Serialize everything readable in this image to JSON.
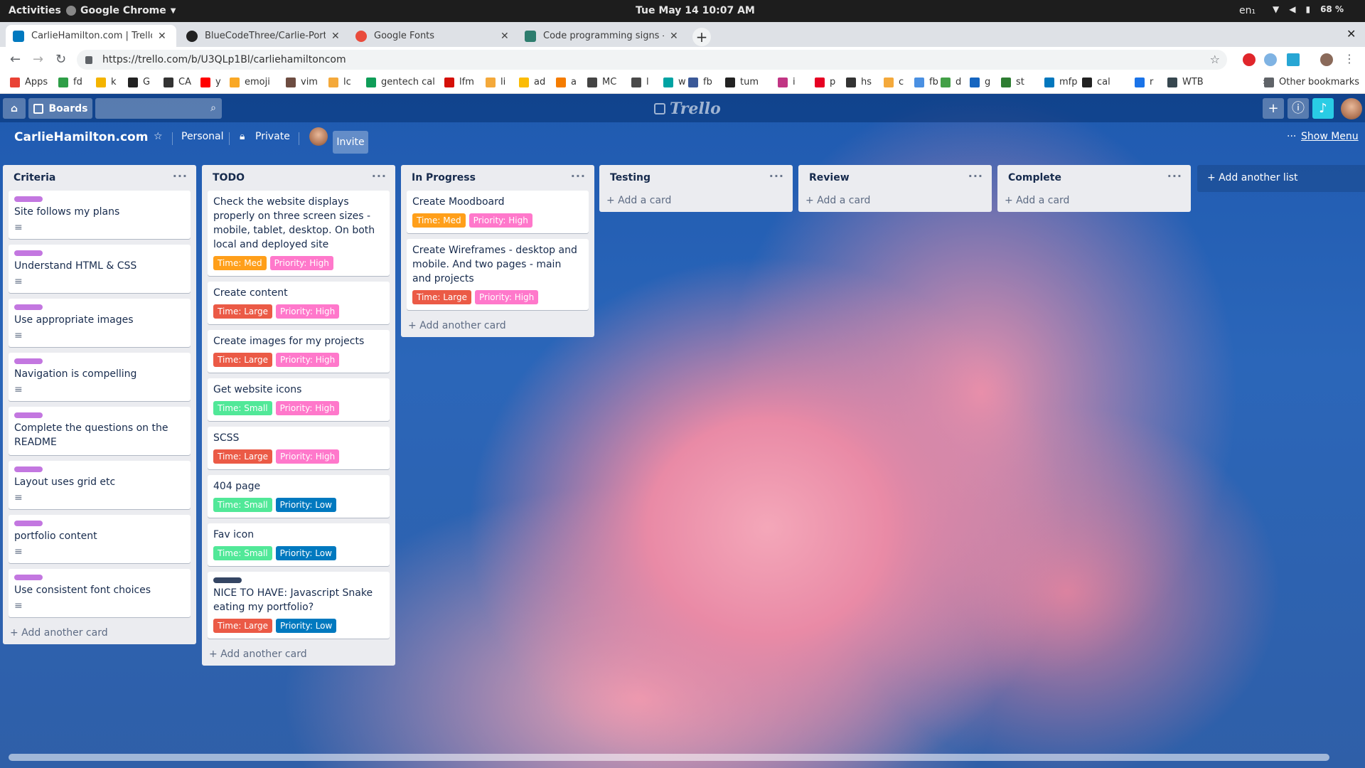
{
  "os": {
    "activities": "Activities",
    "app_name": "Google Chrome",
    "clock": "Tue May 14  10:07 AM",
    "lang": "en₁",
    "battery": "68 %"
  },
  "browser": {
    "tabs": [
      {
        "label": "CarlieHamilton.com | Trello",
        "active": true,
        "favicon_color": "#0079bf"
      },
      {
        "label": "BlueCodeThree/Carlie-Portfo",
        "active": false,
        "favicon_color": "#222222"
      },
      {
        "label": "Google Fonts",
        "active": false,
        "favicon_color": "#e94b3c"
      },
      {
        "label": "Code programming signs - Fre",
        "active": false,
        "favicon_color": "#2e7d6e"
      }
    ],
    "url": "https://trello.com/b/U3QLp1Bl/carliehamiltoncom",
    "bookmarks": [
      {
        "label": "Apps",
        "color": "#e94235"
      },
      {
        "label": "fd",
        "color": "#2e9e47"
      },
      {
        "label": "k",
        "color": "#f4b400"
      },
      {
        "label": "G",
        "color": "#222222"
      },
      {
        "label": "CA",
        "color": "#333333"
      },
      {
        "label": "y",
        "color": "#ff0000"
      },
      {
        "label": "emoji",
        "color": "#f9a825"
      },
      {
        "label": "vim",
        "color": "#6d4c41"
      },
      {
        "label": "lc",
        "color": "#f4a93b"
      },
      {
        "label": "gentech cal",
        "color": "#0f9d58"
      },
      {
        "label": "lfm",
        "color": "#d51007"
      },
      {
        "label": "li",
        "color": "#f4a93b"
      },
      {
        "label": "ad",
        "color": "#fbbc05"
      },
      {
        "label": "a",
        "color": "#f57c00"
      },
      {
        "label": "MC",
        "color": "#444444"
      },
      {
        "label": "l",
        "color": "#4a4a4a"
      },
      {
        "label": "w",
        "color": "#00a3a3"
      },
      {
        "label": "fb",
        "color": "#3b5998"
      },
      {
        "label": "tum",
        "color": "#222222"
      },
      {
        "label": "i",
        "color": "#c13584"
      },
      {
        "label": "p",
        "color": "#e60023"
      },
      {
        "label": "hs",
        "color": "#333333"
      },
      {
        "label": "c",
        "color": "#f4a93b"
      },
      {
        "label": "fb",
        "color": "#4a90e2"
      },
      {
        "label": "d",
        "color": "#43a047"
      },
      {
        "label": "g",
        "color": "#1565c0"
      },
      {
        "label": "st",
        "color": "#2e7d32"
      },
      {
        "label": "mfp",
        "color": "#0277bd"
      },
      {
        "label": "cal",
        "color": "#222222"
      },
      {
        "label": "r",
        "color": "#1a73e8"
      },
      {
        "label": "WTB",
        "color": "#37474f"
      }
    ],
    "overflow": "»",
    "other_bookmarks": "Other bookmarks"
  },
  "trello": {
    "boards_label": "Boards",
    "logo": "Trello",
    "board_title": "CarlieHamilton.com",
    "team": "Personal",
    "visibility": "Private",
    "invite": "Invite",
    "show_menu": "Show Menu",
    "add_another_list": "+ Add another list",
    "add_card": "+ Add a card",
    "add_another_card": "+ Add another card",
    "label_colors": {
      "orange": "#ff9f1a",
      "red": "#eb5a46",
      "pink": "#ff78cb",
      "green": "#61bd4f",
      "teal": "#51e898",
      "blue": "#0079bf",
      "purple": "#c377e0",
      "navy": "#344563"
    },
    "lists": [
      {
        "title": "Criteria",
        "cards": [
          {
            "title": "Site follows my plans",
            "strip": "#c377e0",
            "desc": true,
            "labels": []
          },
          {
            "title": "Understand HTML & CSS",
            "strip": "#c377e0",
            "desc": true,
            "labels": []
          },
          {
            "title": "Use appropriate images",
            "strip": "#c377e0",
            "desc": true,
            "labels": []
          },
          {
            "title": "Navigation is compelling",
            "strip": "#c377e0",
            "desc": true,
            "labels": []
          },
          {
            "title": "Complete the questions on the README",
            "strip": "#c377e0",
            "desc": false,
            "labels": []
          },
          {
            "title": "Layout uses grid etc",
            "strip": "#c377e0",
            "desc": true,
            "labels": []
          },
          {
            "title": "portfolio content",
            "strip": "#c377e0",
            "desc": true,
            "labels": []
          },
          {
            "title": "Use consistent font choices",
            "strip": "#c377e0",
            "desc": true,
            "labels": []
          }
        ],
        "footer": "add_another_card"
      },
      {
        "title": "TODO",
        "cards": [
          {
            "title": "Check the website displays properly on three screen sizes - mobile, tablet, desktop. On both local and deployed site",
            "labels": [
              {
                "text": "Time: Med",
                "color": "#ff9f1a"
              },
              {
                "text": "Priority: High",
                "color": "#ff78cb"
              }
            ]
          },
          {
            "title": "Create content",
            "labels": [
              {
                "text": "Time: Large",
                "color": "#eb5a46"
              },
              {
                "text": "Priority: High",
                "color": "#ff78cb"
              }
            ]
          },
          {
            "title": "Create images for my projects",
            "labels": [
              {
                "text": "Time: Large",
                "color": "#eb5a46"
              },
              {
                "text": "Priority: High",
                "color": "#ff78cb"
              }
            ]
          },
          {
            "title": "Get website icons",
            "labels": [
              {
                "text": "Time: Small",
                "color": "#51e898"
              },
              {
                "text": "Priority: High",
                "color": "#ff78cb"
              }
            ]
          },
          {
            "title": "SCSS",
            "labels": [
              {
                "text": "Time: Large",
                "color": "#eb5a46"
              },
              {
                "text": "Priority: High",
                "color": "#ff78cb"
              }
            ]
          },
          {
            "title": "404 page",
            "labels": [
              {
                "text": "Time: Small",
                "color": "#51e898"
              },
              {
                "text": "Priority: Low",
                "color": "#0079bf"
              }
            ]
          },
          {
            "title": "Fav icon",
            "labels": [
              {
                "text": "Time: Small",
                "color": "#51e898"
              },
              {
                "text": "Priority: Low",
                "color": "#0079bf"
              }
            ]
          },
          {
            "title": "NICE TO HAVE: Javascript Snake eating my portfolio?",
            "strip": "#344563",
            "labels": [
              {
                "text": "Time: Large",
                "color": "#eb5a46"
              },
              {
                "text": "Priority: Low",
                "color": "#0079bf"
              }
            ]
          }
        ],
        "footer": "add_another_card"
      },
      {
        "title": "In Progress",
        "cards": [
          {
            "title": "Create Moodboard",
            "labels": [
              {
                "text": "Time: Med",
                "color": "#ff9f1a"
              },
              {
                "text": "Priority: High",
                "color": "#ff78cb"
              }
            ]
          },
          {
            "title": "Create Wireframes - desktop and mobile. And two pages - main and projects",
            "labels": [
              {
                "text": "Time: Large",
                "color": "#eb5a46"
              },
              {
                "text": "Priority: High",
                "color": "#ff78cb"
              }
            ]
          }
        ],
        "footer": "add_another_card"
      },
      {
        "title": "Testing",
        "cards": [],
        "footer": "add_card"
      },
      {
        "title": "Review",
        "cards": [],
        "footer": "add_card"
      },
      {
        "title": "Complete",
        "cards": [],
        "footer": "add_card"
      }
    ]
  }
}
